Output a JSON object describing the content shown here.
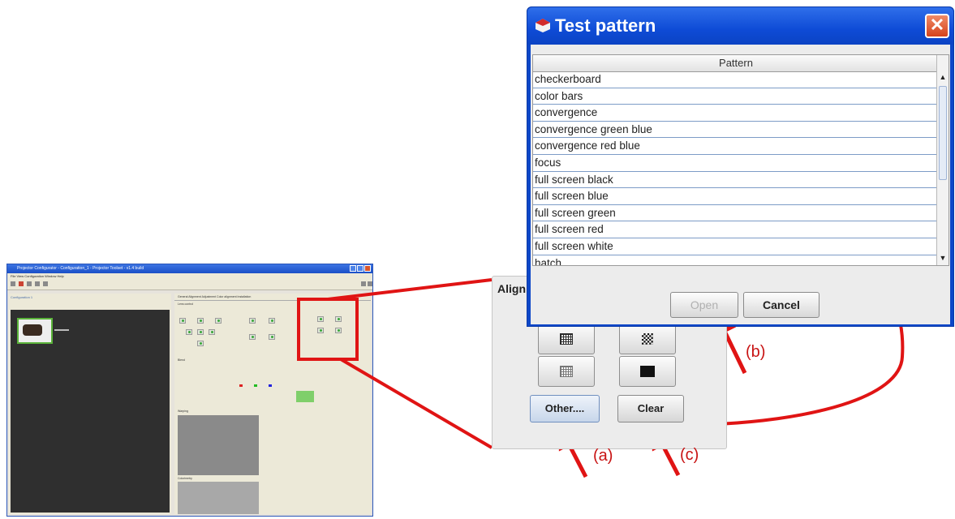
{
  "app": {
    "title": "Projector Configurator - Configuration_1 - Projector Toolset - v1.4 build",
    "menu": "File  View  Configuration  Window  Help",
    "left_header": "Configuration 1",
    "tabs": "General   Alignment   Adjustment   Color alignment   Installation",
    "projector_label": "",
    "section_lens": "Lens control",
    "section_blend": "Blend",
    "section_warp": "Warping",
    "section_colorimetry": "Colorimetry"
  },
  "align_panel": {
    "title": "Align",
    "other_label": "Other....",
    "clear_label": "Clear"
  },
  "dialog": {
    "title": "Test pattern",
    "close_glyph": "✕",
    "column_header": "Pattern",
    "patterns": [
      "checkerboard",
      "color bars",
      "convergence",
      "convergence green blue",
      "convergence red blue",
      "focus",
      "full screen black",
      "full screen blue",
      "full screen green",
      "full screen red",
      "full screen white",
      "hatch"
    ],
    "open_label": "Open",
    "cancel_label": "Cancel"
  },
  "callouts": {
    "a": "(a)",
    "b": "(b)",
    "c": "(c)"
  },
  "colors": {
    "highlight_red": "#e01414",
    "dialog_blue": "#0d47c8",
    "close_orange": "#d5431c"
  },
  "icons": [
    "app-icon",
    "close-icon",
    "grid-icon",
    "checkerboard-icon",
    "hatch-icon",
    "black-square-icon",
    "scroll-up-icon",
    "scroll-down-icon"
  ]
}
